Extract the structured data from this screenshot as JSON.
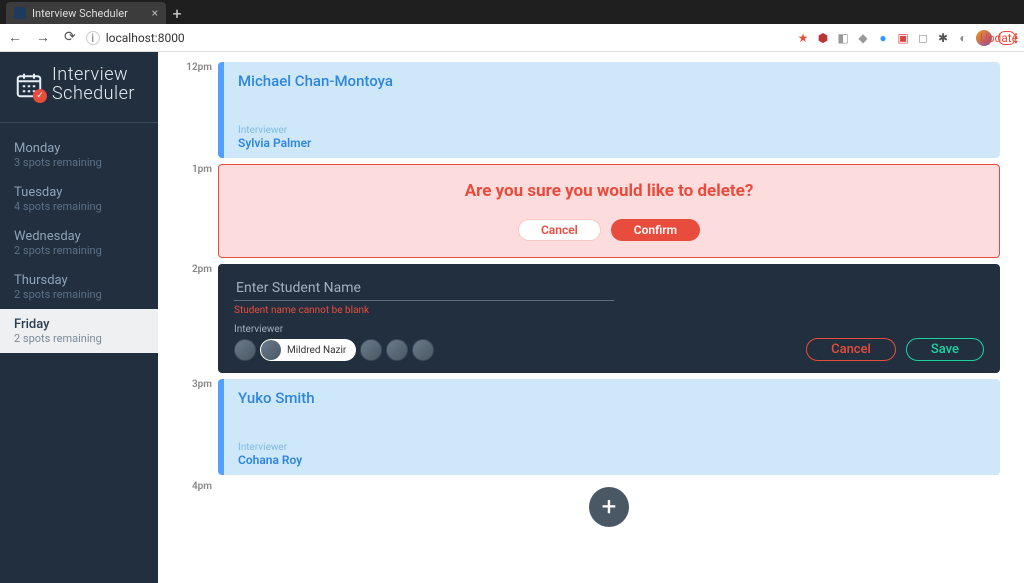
{
  "browser": {
    "tab_title": "Interview Scheduler",
    "url": "localhost:8000",
    "update_label": "Update"
  },
  "app": {
    "logo_line1": "Interview",
    "logo_line2": "Scheduler"
  },
  "days": [
    {
      "name": "Monday",
      "spots": "3 spots remaining",
      "selected": false
    },
    {
      "name": "Tuesday",
      "spots": "4 spots remaining",
      "selected": false
    },
    {
      "name": "Wednesday",
      "spots": "2 spots remaining",
      "selected": false
    },
    {
      "name": "Thursday",
      "spots": "2 spots remaining",
      "selected": false
    },
    {
      "name": "Friday",
      "spots": "2 spots remaining",
      "selected": true
    }
  ],
  "timeslots": [
    "12pm",
    "1pm",
    "2pm",
    "3pm",
    "4pm"
  ],
  "slot_12pm": {
    "student": "Michael Chan-Montoya",
    "interviewer_label": "Interviewer",
    "interviewer": "Sylvia Palmer"
  },
  "slot_1pm": {
    "message": "Are you sure you would like to delete?",
    "cancel": "Cancel",
    "confirm": "Confirm"
  },
  "slot_2pm": {
    "placeholder": "Enter Student Name",
    "value": "",
    "error": "Student name cannot be blank",
    "interviewer_label": "Interviewer",
    "selected_interviewer": "Mildred Nazir",
    "cancel": "Cancel",
    "save": "Save"
  },
  "slot_3pm": {
    "student": "Yuko Smith",
    "interviewer_label": "Interviewer",
    "interviewer": "Cohana Roy"
  }
}
